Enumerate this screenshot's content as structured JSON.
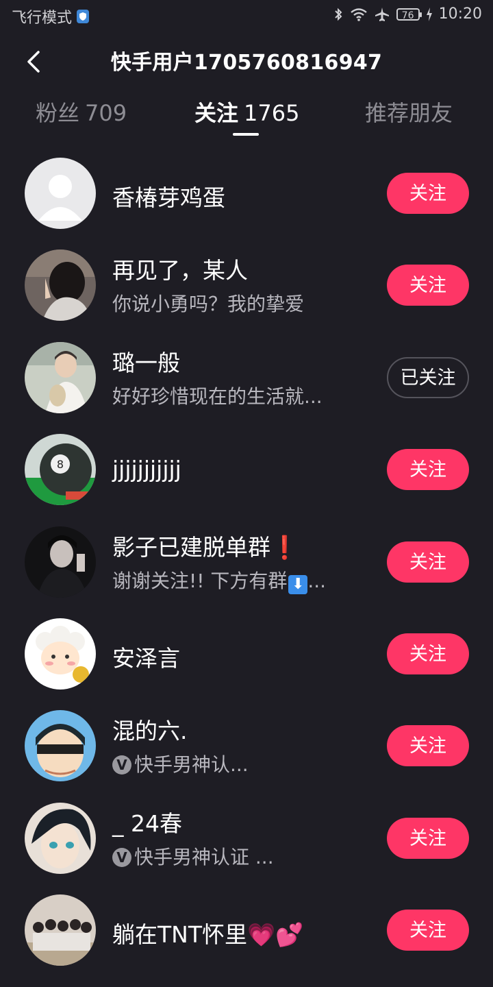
{
  "status_bar": {
    "left_text": "飞行模式",
    "battery": "76",
    "time": "10:20"
  },
  "header": {
    "title": "快手用户1705760816947"
  },
  "tabs": {
    "fans": {
      "label": "粉丝",
      "count": "709"
    },
    "following": {
      "label": "关注",
      "count": "1765"
    },
    "recommend": {
      "label": "推荐朋友"
    }
  },
  "users": [
    {
      "name": "香椿芽鸡蛋",
      "sub": "",
      "button": "关注",
      "avatar": "default-avatar"
    },
    {
      "name": "再见了，某人",
      "sub": "你说小勇吗？我的挚爱",
      "button": "关注",
      "avatar": "girl-photo"
    },
    {
      "name": "璐一般",
      "sub": "好好珍惜现在的生活就...",
      "button": "已关注",
      "avatar": "boy-anime"
    },
    {
      "name": "jjjjjjjjjjj",
      "sub": "",
      "button": "关注",
      "avatar": "billiard-ball"
    },
    {
      "name": "影子已建脱单群",
      "name_emoji": "❗",
      "sub": "谢谢关注!! 下方有群",
      "sub_emoji": "⬇",
      "sub_tail": "...",
      "button": "关注",
      "avatar": "dark-portrait"
    },
    {
      "name": "安泽言",
      "sub": "",
      "button": "关注",
      "avatar": "cartoon-sheep"
    },
    {
      "name": "混的六.",
      "sub": "快手男神认...",
      "badge": "V",
      "button": "关注",
      "avatar": "cartoon-burberry"
    },
    {
      "name": "_ 24春",
      "sub": "快手男神认证 ...",
      "badge": "V",
      "button": "关注",
      "avatar": "anime-boy"
    },
    {
      "name": "躺在TNT怀里",
      "name_emoji": "💗💕",
      "sub": "",
      "button": "关注",
      "avatar": "group-photo"
    }
  ],
  "colors": {
    "background": "#1e1d24",
    "follow_button": "#fe3666",
    "muted_text": "#8e8d94"
  }
}
